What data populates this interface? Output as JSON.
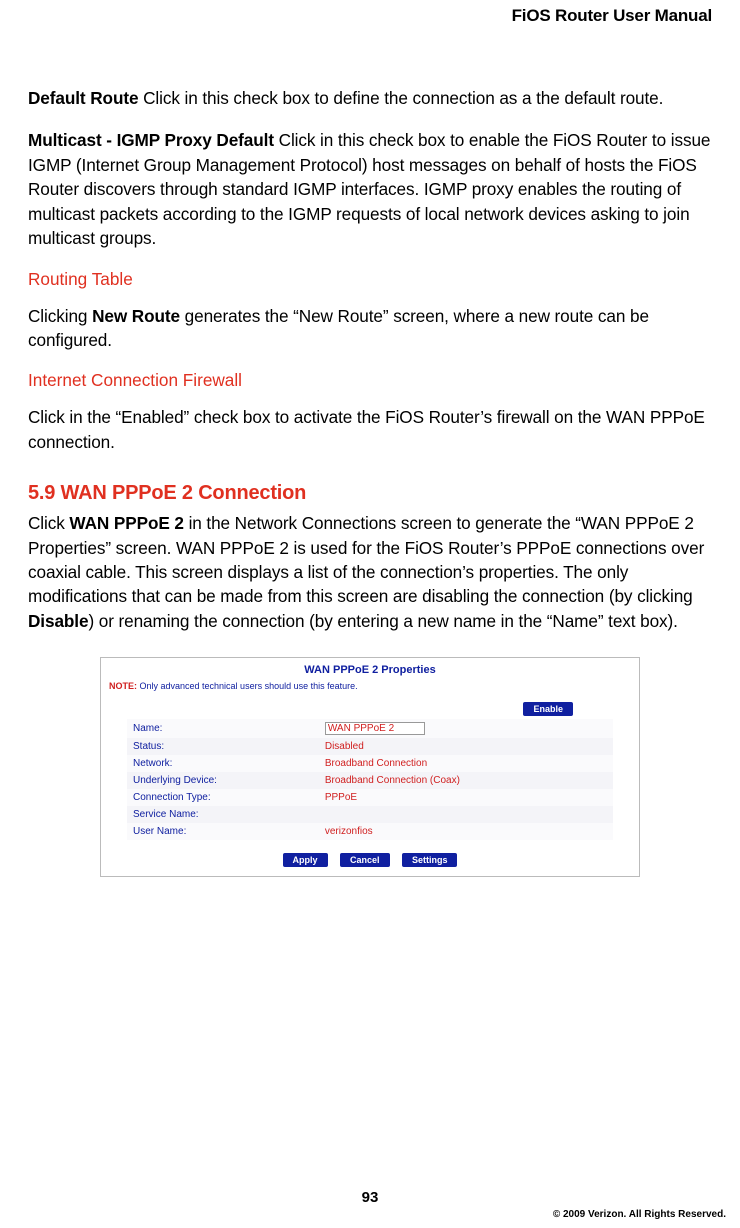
{
  "header": {
    "title": "FiOS Router User Manual"
  },
  "p1": {
    "bold": "Default Route",
    "text": "  Click in this check box to define the connection as a the default route."
  },
  "p2": {
    "bold": "Multicast - IGMP Proxy Default",
    "text": "  Click in this check box to enable the FiOS Router to issue IGMP (Internet Group Management Protocol) host messages on behalf of hosts the FiOS Router discovers through standard IGMP interfaces. IGMP proxy enables the routing of multicast packets according to the IGMP requests of local network devices asking to join multicast groups."
  },
  "sub1": "Routing Table",
  "p3": {
    "pre": "Clicking ",
    "bold": "New Route",
    "post": " generates the “New Route” screen, where a new route can be configured."
  },
  "sub2": "Internet Connection Firewall",
  "p4": "Click in the “Enabled” check box to activate the FiOS Router’s firewall on the WAN PPPoE connection.",
  "section": "5.9  WAN PPPoE 2 Connection",
  "p5": {
    "a": "Click ",
    "b1": "WAN PPPoE 2",
    "b": " in the Network Connections screen to generate the “WAN PPPoE 2 Properties” screen.  WAN PPPoE 2 is used for the FiOS Router’s PPPoE connections over coaxial cable. This screen displays a list of the connection’s properties. The only modifications that can be made from this screen are disabling the connection (by clicking ",
    "b2": "Disable",
    "c": ") or renaming the connection (by entering a new name in the “Name” text box)."
  },
  "panel": {
    "title": "WAN PPPoE 2 Properties",
    "note_label": "NOTE:",
    "note_text": " Only advanced technical users should use this feature.",
    "enable": "Enable",
    "rows": [
      {
        "label": "Name:",
        "value": "WAN PPPoE 2",
        "input": true
      },
      {
        "label": "Status:",
        "value": "Disabled"
      },
      {
        "label": "Network:",
        "value": "Broadband Connection"
      },
      {
        "label": "Underlying Device:",
        "value": "Broadband Connection (Coax)"
      },
      {
        "label": "Connection Type:",
        "value": "PPPoE"
      },
      {
        "label": "Service Name:",
        "value": ""
      },
      {
        "label": "User Name:",
        "value": "verizonfios"
      }
    ],
    "buttons": {
      "apply": "Apply",
      "cancel": "Cancel",
      "settings": "Settings"
    }
  },
  "page_number": "93",
  "copyright": "© 2009 Verizon. All Rights Reserved."
}
